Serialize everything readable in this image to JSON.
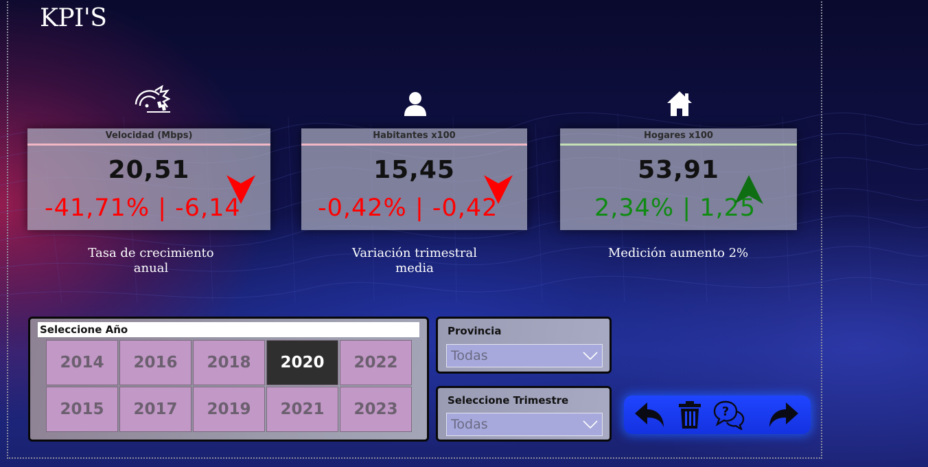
{
  "page": {
    "title": "KPI'S"
  },
  "kpis": [
    {
      "header": "Velocidad (Mbps)",
      "value": "20,51",
      "delta": "-41,71% | -6,14",
      "trend": "down",
      "color": "#ff0000",
      "accent": "#f1b7c5",
      "icon": "speedometer-icon",
      "caption_line1": "Tasa de crecimiento",
      "caption_line2": "anual"
    },
    {
      "header": "Habitantes x100",
      "value": "15,45",
      "delta": "-0,42% | -0,42",
      "trend": "down",
      "color": "#ff0000",
      "accent": "#f1b7c5",
      "icon": "person-icon",
      "caption_line1": "Variación trimestral",
      "caption_line2": "media"
    },
    {
      "header": "Hogares x100",
      "value": "53,91",
      "delta": "2,34% | 1,25",
      "trend": "up",
      "color": "#0f8a12",
      "accent": "#c4e0b4",
      "icon": "house-icon",
      "caption_line1": "Medición aumento 2%",
      "caption_line2": ""
    }
  ],
  "year_slicer": {
    "title": "Seleccione Año",
    "years": [
      "2014",
      "2016",
      "2018",
      "2020",
      "2022",
      "2015",
      "2017",
      "2019",
      "2021",
      "2023"
    ],
    "selected": "2020"
  },
  "filters": {
    "provincia": {
      "label": "Provincia",
      "value": "Todas"
    },
    "trimestre": {
      "label": "Seleccione Trimestre",
      "value": "Todas"
    }
  },
  "nav": {
    "buttons": [
      "back-arrow-icon",
      "trash-icon",
      "help-chat-icon",
      "forward-arrow-icon"
    ]
  },
  "colors": {
    "down": "#ff0000",
    "up": "#0f8a12",
    "nav_bg": "#1f45ff",
    "year_btn": "#c298c6",
    "year_selected": "#2f2f2f"
  }
}
